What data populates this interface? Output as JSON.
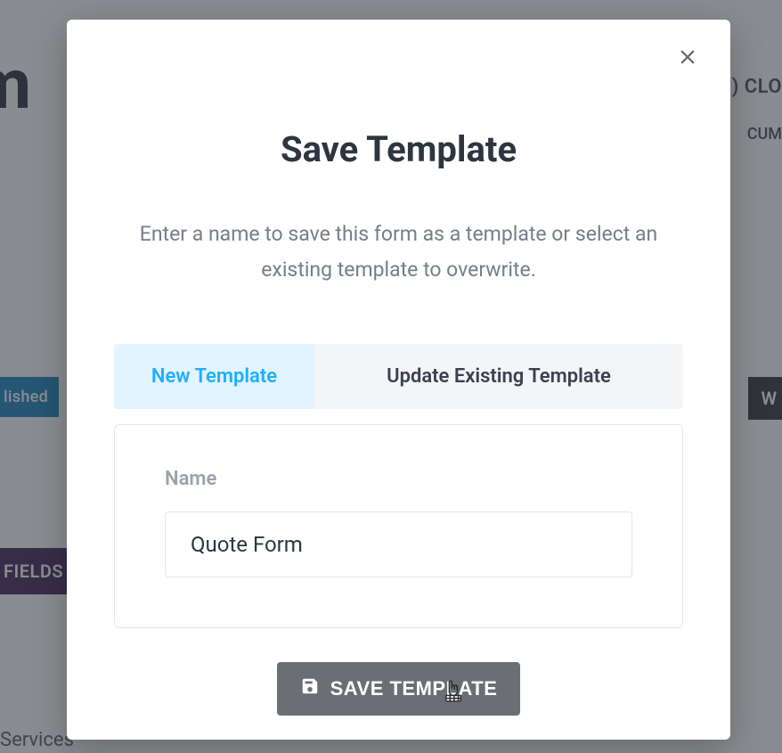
{
  "background": {
    "rm_fragment": "rm",
    "close_fragment": ") CLO",
    "cum_fragment": "CUM",
    "published_fragment": "lished",
    "right_btn_fragment": "W",
    "fields_fragment": "FIELDS",
    "services_fragment": "Services"
  },
  "modal": {
    "title": "Save Template",
    "description": "Enter a name to save this form as a template or select an existing template to overwrite.",
    "tabs": {
      "new": "New Template",
      "update": "Update Existing Template"
    },
    "name_label": "Name",
    "name_value": "Quote Form",
    "save_button": "SAVE TEMPLATE"
  }
}
